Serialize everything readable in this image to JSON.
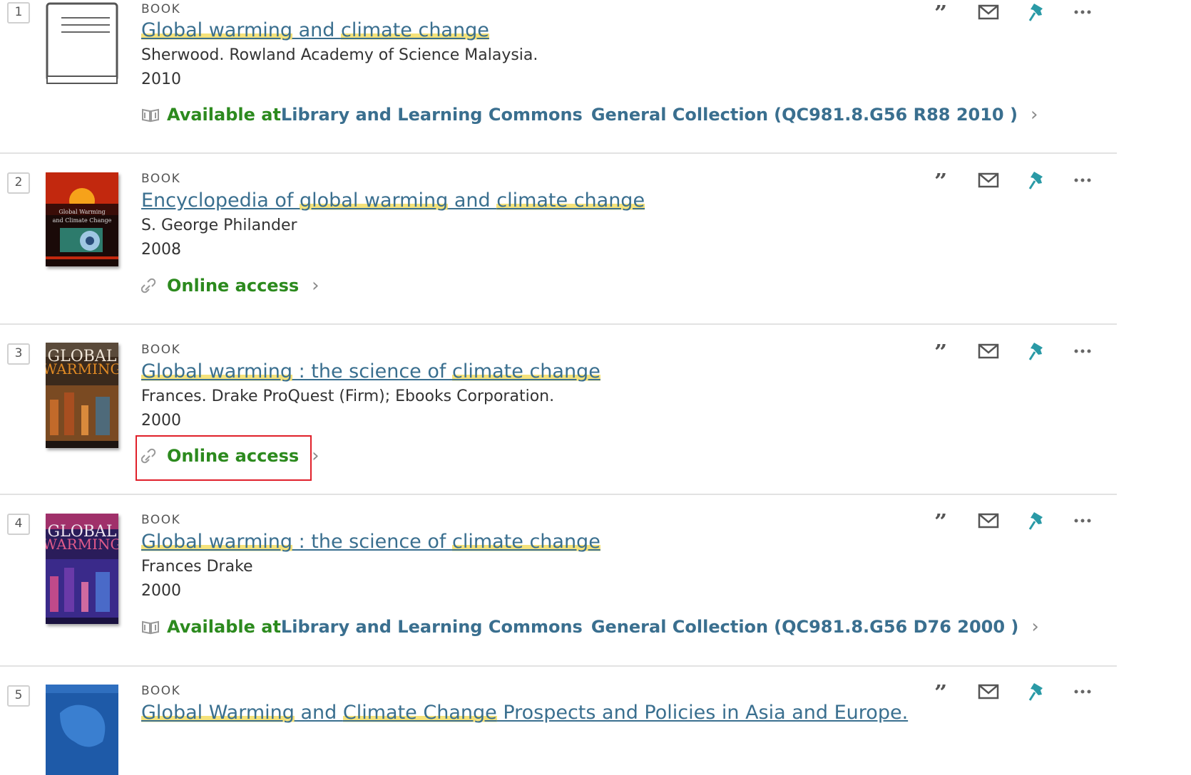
{
  "results": [
    {
      "number": "1",
      "type": "BOOK",
      "title_parts": [
        {
          "text": "Global warming",
          "hl": true
        },
        {
          "text": " and ",
          "hl": false
        },
        {
          "text": "climate change",
          "hl": true
        }
      ],
      "author": "Sherwood. Rowland Academy of Science Malaysia.",
      "year": "2010",
      "availability": {
        "kind": "physical",
        "status": "Available at ",
        "location": "Library and Learning Commons",
        "collection": "General Collection",
        "call_number": "(QC981.8.G56 R88 2010 )"
      },
      "thumbnail": "book-placeholder"
    },
    {
      "number": "2",
      "type": "BOOK",
      "title_parts": [
        {
          "text": "Encyclopedia of ",
          "hl": false
        },
        {
          "text": "global warming",
          "hl": true
        },
        {
          "text": " and ",
          "hl": false
        },
        {
          "text": "climate change",
          "hl": true
        }
      ],
      "author": "S. George Philander",
      "year": "2008",
      "availability": {
        "kind": "online",
        "label": "Online access"
      },
      "thumbnail": "encyclopedia-cover"
    },
    {
      "number": "3",
      "type": "BOOK",
      "title_parts": [
        {
          "text": "Global warming",
          "hl": true
        },
        {
          "text": " : the science of ",
          "hl": false
        },
        {
          "text": "climate change",
          "hl": true
        }
      ],
      "author": "Frances. Drake ProQuest (Firm); Ebooks Corporation.",
      "year": "2000",
      "availability": {
        "kind": "online",
        "label": "Online access"
      },
      "thumbnail": "global-warming-cover-orange"
    },
    {
      "number": "4",
      "type": "BOOK",
      "title_parts": [
        {
          "text": "Global warming",
          "hl": true
        },
        {
          "text": " : the science of ",
          "hl": false
        },
        {
          "text": "climate change",
          "hl": true
        }
      ],
      "author": "Frances Drake",
      "year": "2000",
      "availability": {
        "kind": "physical",
        "status": "Available at ",
        "location": "Library and Learning Commons",
        "collection": "General Collection",
        "call_number": "(QC981.8.G56 D76 2000 )"
      },
      "thumbnail": "global-warming-cover-purple"
    },
    {
      "number": "5",
      "type": "BOOK",
      "title_parts": [
        {
          "text": "Global Warming",
          "hl": true
        },
        {
          "text": " and ",
          "hl": false
        },
        {
          "text": "Climate Change",
          "hl": true
        },
        {
          "text": " Prospects and Policies in Asia and Europe.",
          "hl": false
        }
      ],
      "author": "",
      "year": "",
      "availability": null,
      "thumbnail": "asia-europe-cover"
    }
  ],
  "action_icons": [
    "cite-quote-icon",
    "email-icon",
    "pin-icon",
    "more-icon"
  ],
  "cover_text": {
    "global": "GLOBAL",
    "warming": "WARMING"
  },
  "colors": {
    "link": "#3a6f8f",
    "available": "#2c8a1e",
    "highlight": "#f5e27a",
    "icon_teal": "#2a9aa6",
    "focus_box": "#e0202a"
  }
}
